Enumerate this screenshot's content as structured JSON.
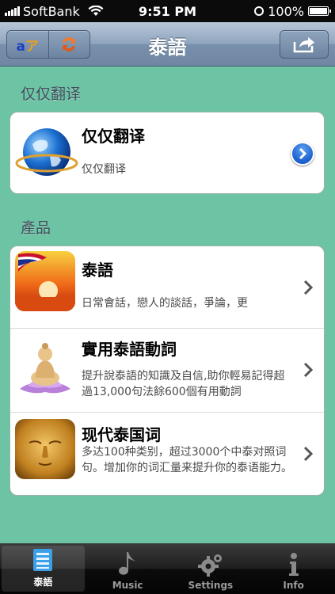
{
  "status_bar": {
    "carrier": "SoftBank",
    "time": "9:51 PM",
    "battery": "100%",
    "battery_level": 1.0
  },
  "nav_bar": {
    "title": "泰語"
  },
  "sections": [
    {
      "header": "仅仅翻译",
      "rows": [
        {
          "title": "仅仅翻译",
          "subtitle": "仅仅翻译",
          "icon": "globe-icon",
          "accessory": "detail-disclosure"
        }
      ]
    },
    {
      "header": "產品",
      "rows": [
        {
          "title": "泰語",
          "subtitle": "日常會話，戀人的談話，爭論，更",
          "icon": "thailand-flag-sunset-icon",
          "accessory": "chevron"
        },
        {
          "title": "實用泰語動詞",
          "subtitle": "提升說泰語的知識及自信,助你輕易記得超過13,000句法餘600個有用動詞",
          "icon": "buddha-icon",
          "accessory": "chevron"
        },
        {
          "title": "现代泰国词",
          "subtitle": "多达100种类别，超过3000个中泰对照词句。增加你的词汇量来提升你的泰语能力。",
          "icon": "buddha-face-icon",
          "accessory": "chevron"
        }
      ]
    }
  ],
  "tab_bar": {
    "tabs": [
      {
        "label": "泰語",
        "icon": "list-icon",
        "active": true
      },
      {
        "label": "Music",
        "icon": "music-note-icon",
        "active": false
      },
      {
        "label": "Settings",
        "icon": "gear-icon",
        "active": false
      },
      {
        "label": "Info",
        "icon": "info-icon",
        "active": false
      }
    ]
  },
  "colors": {
    "background": "#6cc4a4",
    "nav_bar": "#7890ab",
    "tab_active": "#3ba0e8",
    "disclosure": "#1c5fcf"
  }
}
